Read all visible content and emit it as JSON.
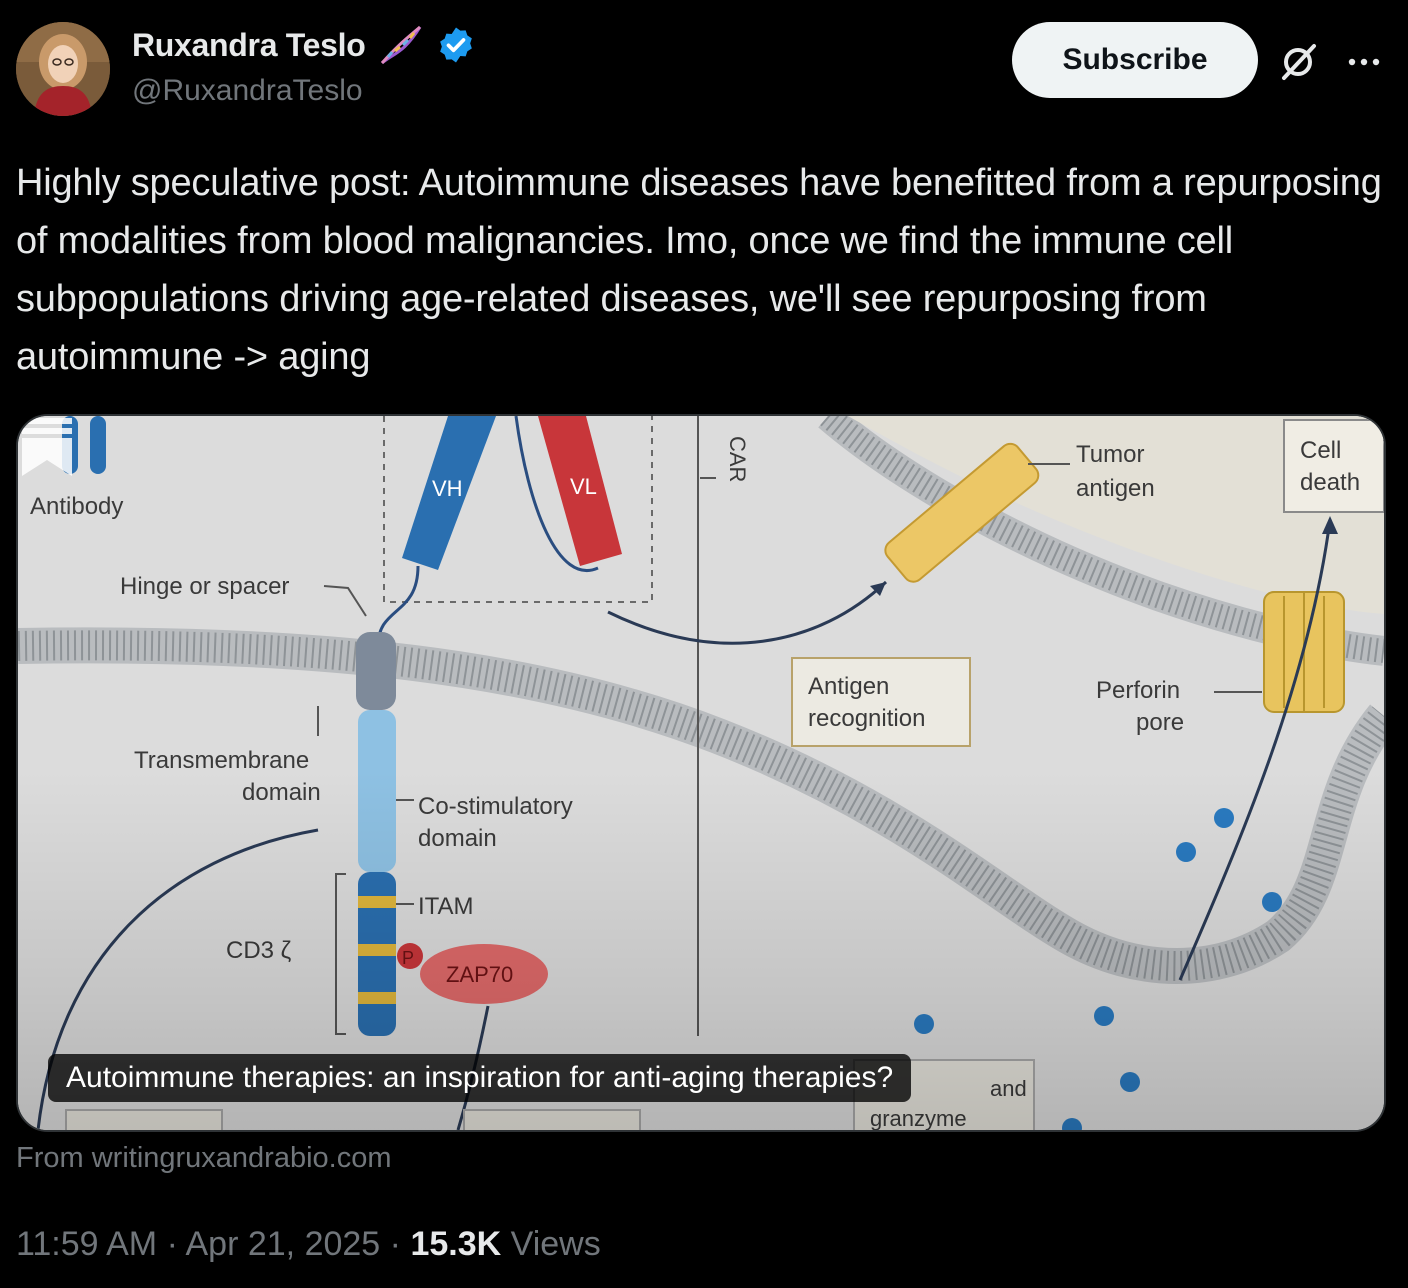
{
  "author": {
    "display_name": "Ruxandra Teslo",
    "handle": "@RuxandraTeslo",
    "badges": [
      "dna-icon",
      "verified-badge-icon"
    ]
  },
  "actions": {
    "subscribe_label": "Subscribe",
    "icons": [
      "grok-icon",
      "more-icon"
    ]
  },
  "post": {
    "text": "Highly speculative post: Autoimmune diseases have benefitted from a repurposing of modalities from blood malignancies. Imo, once we find the immune cell subpopulations driving age-related diseases, we'll see repurposing from autoimmune -> aging"
  },
  "card": {
    "title": "Autoimmune therapies: an inspiration for anti-aging therapies?",
    "source": "From writingruxandrabio.com",
    "image_labels": {
      "antibody": "Antibody",
      "vh": "VH",
      "vl": "VL",
      "car": "CAR",
      "hinge": "Hinge or spacer",
      "transmembrane_1": "Transmembrane",
      "transmembrane_2": "domain",
      "costim_1": "Co-stimulatory",
      "costim_2": "domain",
      "itam": "ITAM",
      "cd3": "CD3 ζ",
      "p": "P",
      "zap70": "ZAP70",
      "tumor_1": "Tumor",
      "tumor_2": "antigen",
      "cell_death_1": "Cell",
      "cell_death_2": "death",
      "antigen_rec_1": "Antigen",
      "antigen_rec_2": "recognition",
      "perforin_1": "Perforin",
      "perforin_2": "pore",
      "granzyme_1": "and",
      "granzyme_2": "granzyme"
    }
  },
  "meta": {
    "time": "11:59 AM",
    "separator": "·",
    "date": "Apr 21, 2025",
    "views_count": "15.3K",
    "views_label": "Views"
  }
}
